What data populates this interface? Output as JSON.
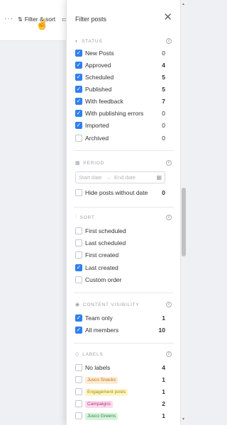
{
  "toolbar": {
    "more_label": "···",
    "filter_sort_label": "Filter & sort"
  },
  "panel": {
    "title": "Filter posts",
    "close_label": "✕"
  },
  "status": {
    "header": "STATUS",
    "items": [
      {
        "label": "New Posts",
        "count": "0",
        "checked": true
      },
      {
        "label": "Approved",
        "count": "4",
        "checked": true
      },
      {
        "label": "Scheduled",
        "count": "5",
        "checked": true
      },
      {
        "label": "Published",
        "count": "5",
        "checked": true
      },
      {
        "label": "With feedback",
        "count": "7",
        "checked": true
      },
      {
        "label": "With publishing errors",
        "count": "0",
        "checked": true
      },
      {
        "label": "Imported",
        "count": "0",
        "checked": true
      },
      {
        "label": "Archived",
        "count": "0",
        "checked": false
      }
    ]
  },
  "period": {
    "header": "PERIOD",
    "start_placeholder": "Start date",
    "end_placeholder": "End date",
    "arrow": "→",
    "hide_label": "Hide posts without date",
    "hide_count": "0",
    "hide_checked": false
  },
  "sort": {
    "header": "SORT",
    "items": [
      {
        "label": "First scheduled",
        "checked": false
      },
      {
        "label": "Last scheduled",
        "checked": false
      },
      {
        "label": "First created",
        "checked": false
      },
      {
        "label": "Last created",
        "checked": true
      },
      {
        "label": "Custom order",
        "checked": false
      }
    ]
  },
  "visibility": {
    "header": "CONTENT VISIBILITY",
    "items": [
      {
        "label": "Team only",
        "count": "1",
        "checked": true
      },
      {
        "label": "All members",
        "count": "10",
        "checked": true
      }
    ]
  },
  "labels": {
    "header": "LABELS",
    "no_labels": {
      "label": "No labels",
      "count": "4",
      "checked": false
    },
    "items": [
      {
        "label": "Jusco Snacks",
        "count": "1",
        "checked": false,
        "bg": "#fdebd3",
        "fg": "#c0741b"
      },
      {
        "label": "Engagement posts",
        "count": "1",
        "checked": false,
        "bg": "#fdf5c4",
        "fg": "#a98712"
      },
      {
        "label": "Campaigns",
        "count": "2",
        "checked": false,
        "bg": "#fbd9ee",
        "fg": "#b8357f"
      },
      {
        "label": "Jusco Greens",
        "count": "1",
        "checked": false,
        "bg": "#d7f2dc",
        "fg": "#2f8a45"
      }
    ]
  },
  "colors": {
    "accent": "#2f80ed",
    "section_header": "#9aa0a6",
    "panel_bg": "#ffffff",
    "backdrop": "#eef0f3"
  }
}
